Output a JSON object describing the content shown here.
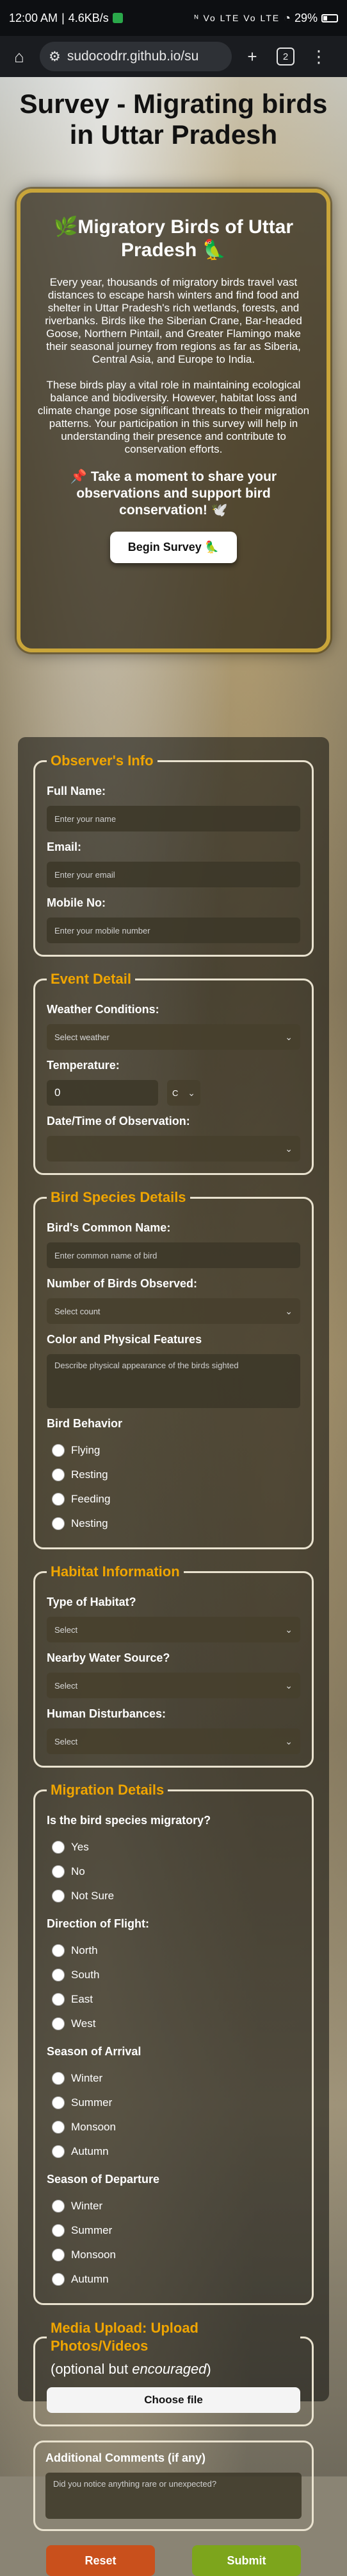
{
  "status_bar": {
    "time": "12:00 AM",
    "speed": "4.6KB/s",
    "signal": "ᴺ Vo LTE Vo LTE",
    "battery": "29%"
  },
  "browser": {
    "url": "sudocodrr.github.io/su",
    "tab_count": "2",
    "icons": {
      "home": "home-icon",
      "site_settings": "site-settings-icon",
      "new_tab": "plus-icon",
      "menu": "more-vertical-icon"
    }
  },
  "page_title": "Survey - Migrating birds in Uttar Pradesh",
  "intro": {
    "title": "🌿Migratory Birds of Uttar Pradesh 🦜",
    "para1": "Every year, thousands of migratory birds travel vast distances to escape harsh winters and find food and shelter in Uttar Pradesh's rich wetlands, forests, and riverbanks. Birds like the Siberian Crane, Bar-headed Goose, Northern Pintail, and Greater Flamingo make their seasonal journey from regions as far as Siberia, Central Asia, and Europe to India.",
    "para2": "These birds play a vital role in maintaining ecological balance and biodiversity. However, habitat loss and climate change pose significant threats to their migration patterns. Your participation in this survey will help in understanding their presence and contribute to conservation efforts.",
    "cta": "📌 Take a moment to share your observations and support bird conservation! 🕊️",
    "begin_button": "Begin Survey 🦜"
  },
  "observer": {
    "legend": "Observer's Info",
    "name_label": "Full Name:",
    "name_placeholder": "Enter your name",
    "email_label": "Email:",
    "email_placeholder": "Enter your email",
    "mobile_label": "Mobile No:",
    "mobile_placeholder": "Enter your mobile number"
  },
  "event": {
    "legend": "Event Detail",
    "weather_label": "Weather Conditions:",
    "weather_value": "Select weather",
    "temp_label": "Temperature:",
    "temp_value": "0",
    "temp_unit": "C",
    "datetime_label": "Date/Time of Observation:"
  },
  "species": {
    "legend": "Bird Species Details",
    "common_name_label": "Bird's Common Name:",
    "common_name_placeholder": "Enter common name of bird",
    "count_label": "Number of Birds Observed:",
    "count_value": "Select count",
    "color_label": "Color and Physical Features",
    "color_placeholder": "Describe physical appearance of the birds sighted",
    "behavior_label": "Bird Behavior",
    "behaviors": [
      "Flying",
      "Resting",
      "Feeding",
      "Nesting"
    ]
  },
  "habitat": {
    "legend": "Habitat Information",
    "type_label": "Type of Habitat?",
    "type_value": "Select",
    "water_label": "Nearby Water Source?",
    "water_value": "Select",
    "disturb_label": "Human Disturbances:",
    "disturb_value": "Select"
  },
  "migration": {
    "legend": "Migration Details",
    "q1": "Is the bird species migratory?",
    "q1_opts": [
      "Yes",
      "No",
      "Not Sure"
    ],
    "q2": "Direction of Flight:",
    "q2_opts": [
      "North",
      "South",
      "East",
      "West"
    ],
    "q3": "Season of Arrival",
    "q3_opts": [
      "Winter",
      "Summer",
      "Monsoon",
      "Autumn"
    ],
    "q4": "Season of Departure",
    "q4_opts": [
      "Winter",
      "Summer",
      "Monsoon",
      "Autumn"
    ]
  },
  "upload": {
    "legend": "Media Upload: Upload Photos/Videos",
    "sub_prefix": "(optional but ",
    "sub_em": "encouraged",
    "sub_suffix": ")",
    "button": "Choose file"
  },
  "comments": {
    "title": "Additional Comments (if any)",
    "placeholder": "Did you notice anything rare or unexpected?"
  },
  "actions": {
    "reset": "Reset",
    "submit": "Submit"
  },
  "colors": {
    "accent": "#f0a500",
    "card_border": "#c9a53a",
    "reset": "#c9501c",
    "submit": "#7da51c"
  }
}
